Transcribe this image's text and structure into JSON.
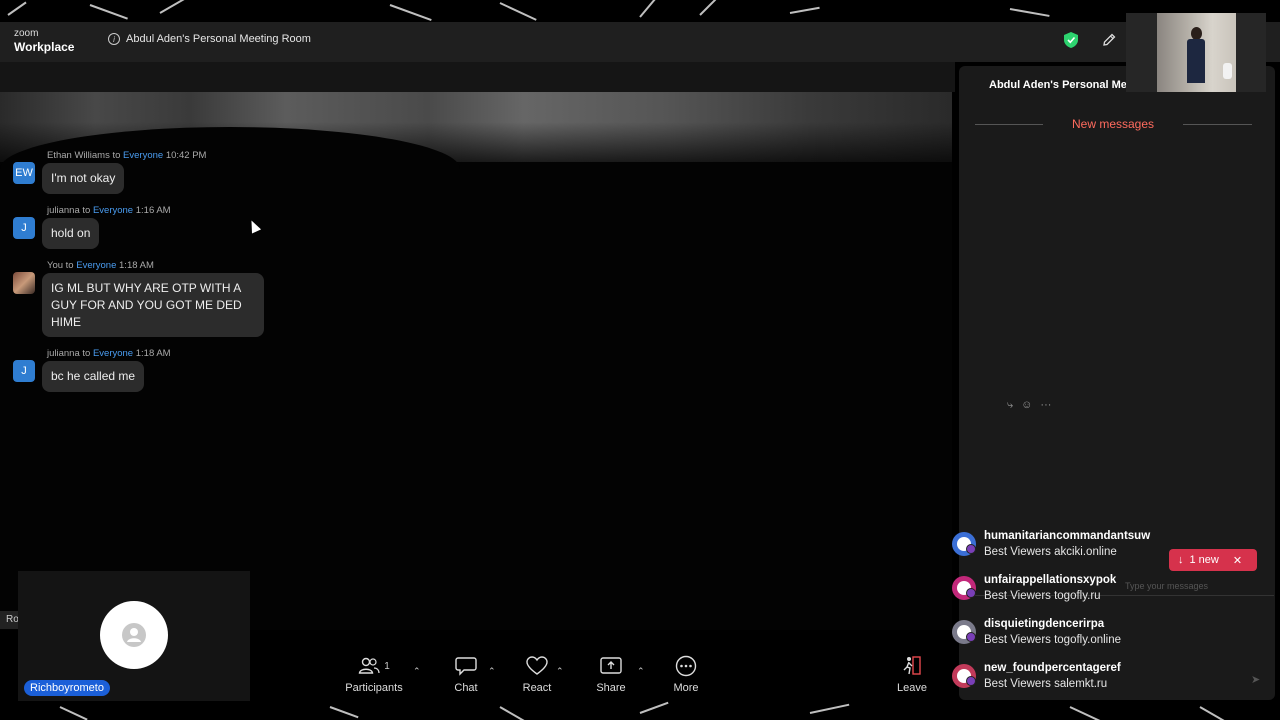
{
  "titlebar": {
    "logo_top": "zoom",
    "logo_bottom": "Workplace",
    "meeting_title": "Abdul Aden's Personal Meeting Room",
    "shield_color": "#2dd36f"
  },
  "self_view": {
    "name": "Richboyrometo",
    "partial_label": "Ro"
  },
  "toolbar": {
    "participants_label": "Participants",
    "participants_count": "1",
    "chat_label": "Chat",
    "react_label": "React",
    "share_label": "Share",
    "more_label": "More",
    "leave_label": "Leave"
  },
  "chat": {
    "title": "Abdul Aden's Personal Meeting Room",
    "new_messages_label": "New messages",
    "messages": [
      {
        "initials": "EW",
        "sender": "Ethan Williams",
        "to": " to ",
        "recipient": "Everyone",
        "time": "10:42 PM",
        "text": "I'm not okay"
      },
      {
        "initials": "J",
        "sender": "julianna",
        "to": " to ",
        "recipient": "Everyone",
        "time": "1:16 AM",
        "text": "hold on"
      },
      {
        "initials": "",
        "sender": "You",
        "to": " to ",
        "recipient": "Everyone",
        "time": "1:18 AM",
        "text": "IG ML BUT WHY ARE OTP WITH A GUY FOR AND YOU GOT ME DED HIME"
      },
      {
        "initials": "J",
        "sender": "julianna",
        "to": " to ",
        "recipient": "Everyone",
        "time": "1:18 AM",
        "text": "bc he called me"
      }
    ],
    "new_badge": "1 new",
    "input_placeholder_partial": "Type your messages"
  },
  "notifications": [
    {
      "name": "humanitariancommandantsuw",
      "text": "Best Viewers akciki.online",
      "color": "#3b6fd6"
    },
    {
      "name": "unfairappellationsxypok",
      "text": "Best Viewers togofly.ru",
      "color": "#c2287a"
    },
    {
      "name": "disquietingdencerirpa",
      "text": "Best Viewers togofly.online",
      "color": "#7a7a8a"
    },
    {
      "name": "new_foundpercentageref",
      "text": "Best Viewers salemkt.ru",
      "color": "#c23a5a"
    }
  ]
}
